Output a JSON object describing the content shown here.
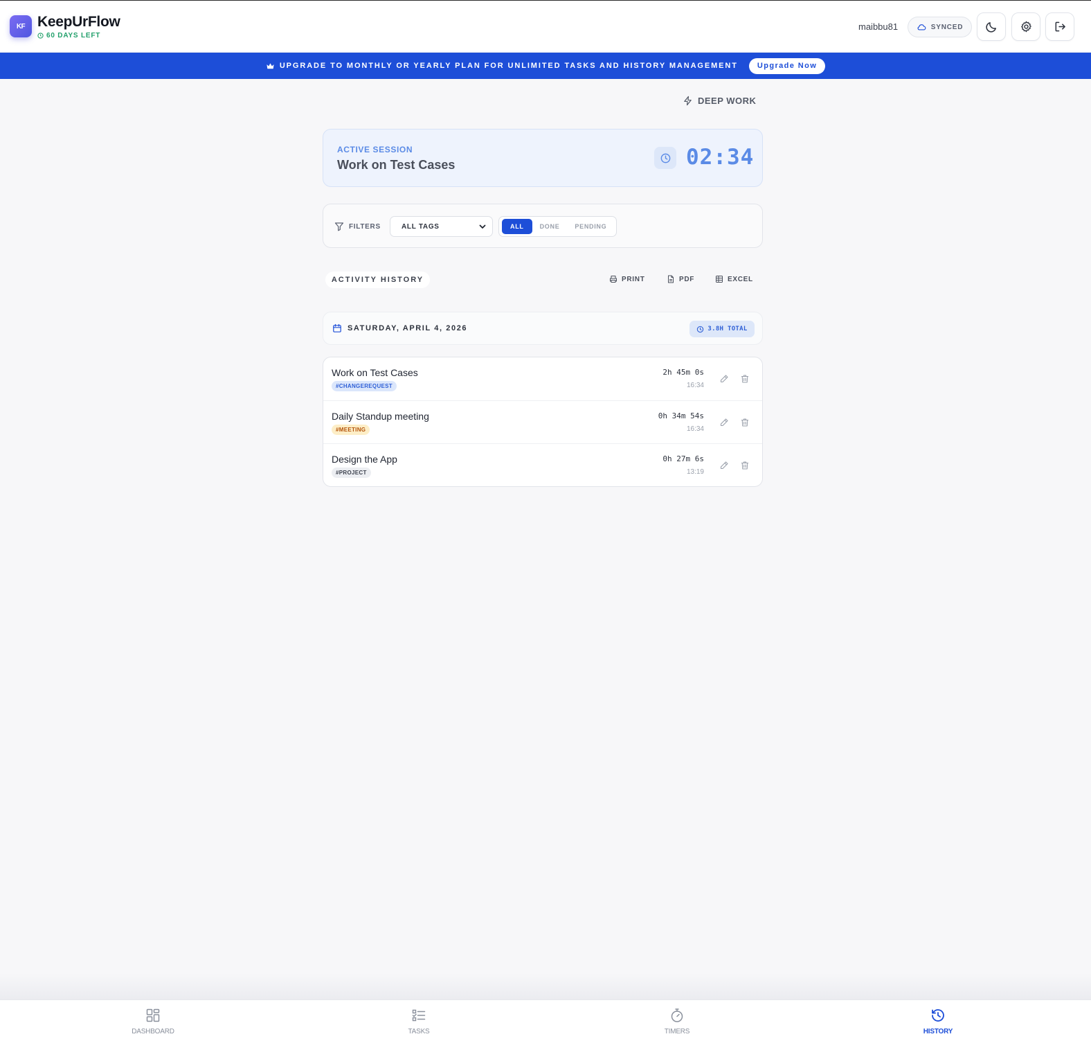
{
  "header": {
    "logo_text": "KF",
    "brand": "KeepUrFlow",
    "days_left": "60 DAYS LEFT",
    "username": "maibbu81",
    "sync_status": "SYNCED"
  },
  "banner": {
    "message": "UPGRADE TO MONTHLY OR YEARLY PLAN FOR UNLIMITED TASKS AND HISTORY MANAGEMENT",
    "cta": "Upgrade Now"
  },
  "mode": {
    "label": "DEEP WORK"
  },
  "session": {
    "label": "ACTIVE SESSION",
    "title": "Work on Test Cases",
    "elapsed": "02:34"
  },
  "filters": {
    "label": "FILTERS",
    "tag_select": "ALL TAGS",
    "status_options": [
      "ALL",
      "DONE",
      "PENDING"
    ],
    "selected_status": "ALL"
  },
  "history": {
    "title": "ACTIVITY HISTORY",
    "actions": {
      "print": "PRINT",
      "pdf": "PDF",
      "excel": "EXCEL"
    }
  },
  "day": {
    "date": "SATURDAY, APRIL 4, 2026",
    "total": "3.8H TOTAL"
  },
  "tasks": [
    {
      "title": "Work on Test Cases",
      "tag": "#CHANGEREQUEST",
      "duration": "2h 45m 0s",
      "time": "16:34"
    },
    {
      "title": "Daily Standup meeting",
      "tag": "#MEETING",
      "duration": "0h 34m 54s",
      "time": "16:34"
    },
    {
      "title": "Design the App",
      "tag": "#PROJECT",
      "duration": "0h 27m 6s",
      "time": "13:19"
    }
  ],
  "tag_colors": {
    "#CHANGEREQUEST": {
      "bg": "#dbe6fb",
      "fg": "#2e5fd6"
    },
    "#MEETING": {
      "bg": "#fdeec7",
      "fg": "#b45309"
    },
    "#PROJECT": {
      "bg": "#eceef2",
      "fg": "#3a3f4b"
    }
  },
  "bottom_nav": {
    "items": [
      {
        "label": "DASHBOARD",
        "icon": "dashboard-grid-icon"
      },
      {
        "label": "TASKS",
        "icon": "task-list-icon"
      },
      {
        "label": "TIMERS",
        "icon": "stopwatch-icon"
      },
      {
        "label": "HISTORY",
        "icon": "history-clock-icon"
      }
    ],
    "active": "HISTORY"
  },
  "colors": {
    "primary": "#1d4ed8",
    "accent_blue": "#5b8be6",
    "success": "#22a06b"
  }
}
